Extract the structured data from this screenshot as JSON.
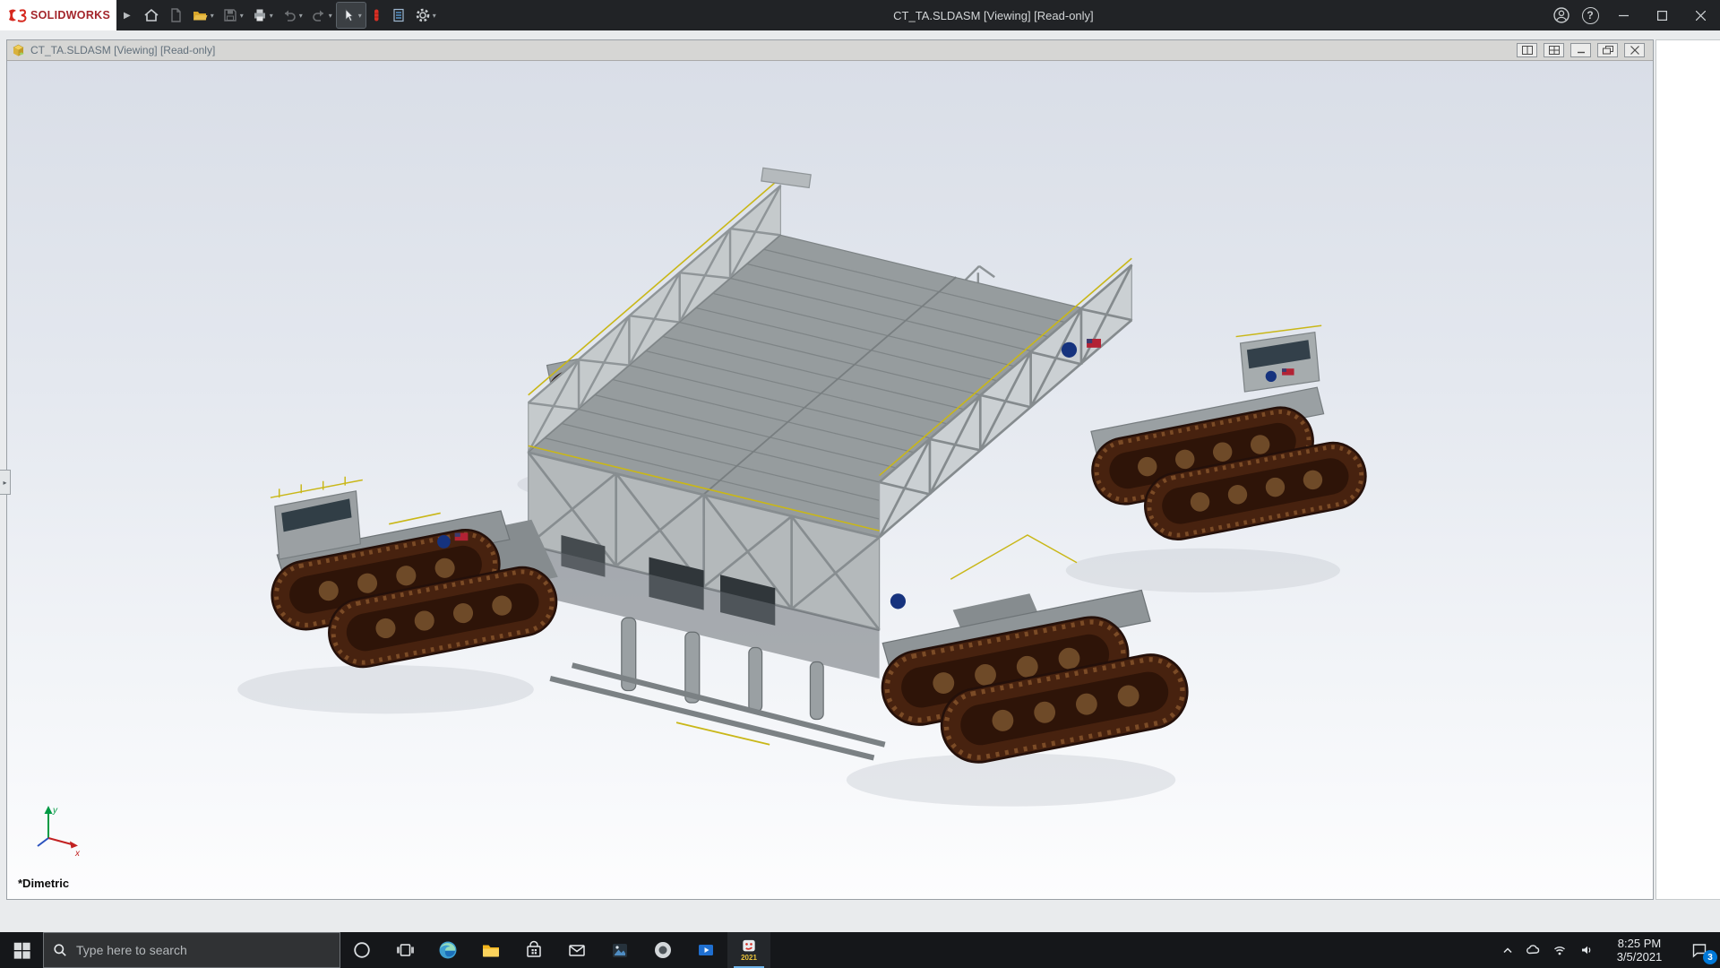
{
  "app": {
    "brand": "SOLIDWORKS",
    "title": "CT_TA.SLDASM [Viewing] [Read-only]"
  },
  "document": {
    "title": "CT_TA.SLDASM [Viewing] [Read-only]",
    "view_orientation": "*Dimetric",
    "triad": {
      "x": "x",
      "y": "y"
    }
  },
  "icons": {
    "caret": "▾",
    "menu_expand": "▶",
    "help": "?",
    "panel_tab": "▸"
  },
  "toolbar": {
    "items": [
      {
        "name": "home",
        "enabled": true
      },
      {
        "name": "new-file",
        "enabled": false
      },
      {
        "name": "open-file",
        "enabled": true
      },
      {
        "name": "save",
        "enabled": false
      },
      {
        "name": "print",
        "enabled": true
      },
      {
        "name": "undo",
        "enabled": false
      },
      {
        "name": "redo",
        "enabled": false
      },
      {
        "name": "select",
        "enabled": true,
        "active": true
      },
      {
        "name": "rebuild-stoplight",
        "enabled": true
      },
      {
        "name": "file-properties",
        "enabled": true
      },
      {
        "name": "options",
        "enabled": true
      }
    ]
  },
  "titlebar_controls": [
    "account",
    "help",
    "minimize",
    "maximize",
    "close"
  ],
  "document_controls": [
    "split-view",
    "four-view",
    "minimize",
    "restore",
    "close"
  ],
  "taskbar": {
    "search_placeholder": "Type here to search",
    "time": "8:25 PM",
    "date": "3/5/2021",
    "notification_count": "3",
    "sw_year": "2021",
    "apps": [
      "start",
      "search",
      "cortana",
      "task-view",
      "edge",
      "file-explorer",
      "store",
      "mail",
      "photos",
      "app-circle",
      "movies-tv",
      "solidworks-2021"
    ],
    "tray": [
      "hidden-icons-chevron",
      "onedrive",
      "network",
      "volume",
      "action-center"
    ]
  },
  "colors": {
    "accent": "#0078d7",
    "brand_red": "#d6281e",
    "titlebar": "#212326",
    "taskbar": "#15171a",
    "deck_gray": "#969c9e",
    "track_brown": "#47220f",
    "railing_yellow": "#c9b718",
    "nasa_blue": "#16337e"
  }
}
